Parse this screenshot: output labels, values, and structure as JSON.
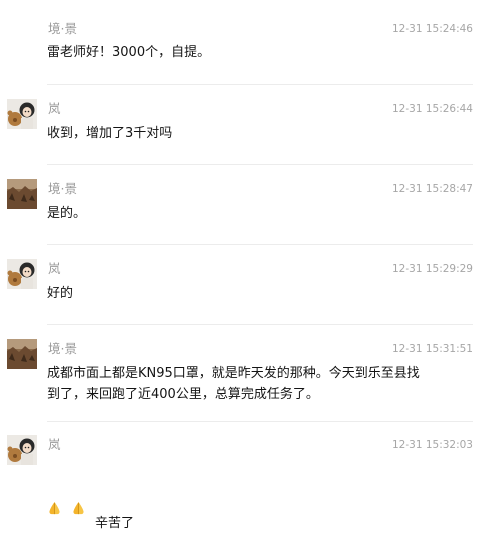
{
  "messages": [
    {
      "sender": "境·景",
      "time": "12-31 15:24:46",
      "text": "雷老师好！3000个，自提。",
      "avatar": "none"
    },
    {
      "sender": "岚",
      "time": "12-31 15:26:44",
      "text": "收到，增加了3千对吗",
      "avatar": "girl-with-teddy-bear"
    },
    {
      "sender": "境·景",
      "time": "12-31 15:28:47",
      "text": "是的。",
      "avatar": "brown-landscape-photo"
    },
    {
      "sender": "岚",
      "time": "12-31 15:29:29",
      "text": "好的",
      "avatar": "girl-with-teddy-bear"
    },
    {
      "sender": "境·景",
      "time": "12-31 15:31:51",
      "text": "成都市面上都是KN95口罩，就是昨天发的那种。今天到乐至县找\n到了，来回跑了近400公里，总算完成任务了。",
      "avatar": "brown-landscape-photo"
    },
    {
      "sender": "岚",
      "time": "12-31 15:32:03",
      "text": "辛苦了",
      "emoji": [
        "folded-hands-icon",
        "folded-hands-icon"
      ],
      "avatar": "girl-with-teddy-bear"
    }
  ]
}
